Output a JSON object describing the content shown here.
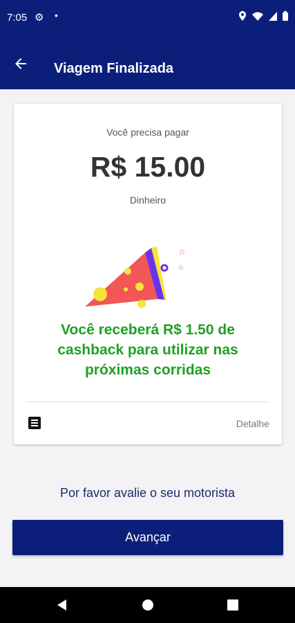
{
  "status_bar": {
    "time": "7:05",
    "icons": [
      "gear-icon",
      "dot-icon",
      "location-icon",
      "wifi-icon",
      "signal-icon",
      "battery-icon"
    ]
  },
  "app_bar": {
    "title": "Viagem Finalizada",
    "back_icon": "arrow-back-icon"
  },
  "payment": {
    "label": "Você precisa pagar",
    "amount": "R$ 15.00",
    "method": "Dinheiro"
  },
  "cashback": {
    "message": "Você receberá R$ 1.50 de cashback para utilizar nas próximas corridas"
  },
  "details": {
    "icon": "list-icon",
    "label": "Detalhe"
  },
  "rating_prompt": "Por favor avalie o seu motorista",
  "advance_button": "Avançar",
  "nav_bar": {
    "icons": [
      "back-triangle-icon",
      "home-circle-icon",
      "recents-square-icon"
    ]
  },
  "colors": {
    "primary": "#0b1f7a",
    "cashback_green": "#1fa024",
    "pizza_red": "#f25656",
    "yellow": "#f5e53a",
    "purple": "#6a34e6"
  }
}
